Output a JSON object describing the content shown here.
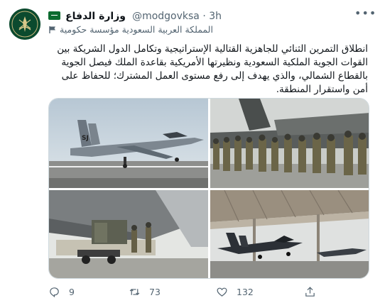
{
  "tweet": {
    "display_name": "وزارة الدفاع",
    "handle": "@modgovksa",
    "separator": "·",
    "time": "3h",
    "label": "المملكة العربية السعودية مؤسسة حكومية",
    "text": "انطلاق التمرين الثنائي للجاهزية القتالية الإستراتيجية وتكامل الدول الشريكة بين القوات الجوية الملكية السعودية ونظيرتها الأمريكية بقاعدة الملك فيصل الجوية بالقطاع الشمالي، والذي يهدف إلى رفع مستوى العمل المشترك؛ للحفاظ على أمن واستقرار المنطقة.",
    "media": [
      {
        "icon": "fighter-jet-photo",
        "tail_code": "SJ"
      },
      {
        "icon": "soldiers-cargo-plane-photo"
      },
      {
        "icon": "cargo-loading-photo"
      },
      {
        "icon": "hangar-jet-photo"
      }
    ]
  },
  "actions": {
    "reply_count": "9",
    "retweet_count": "73",
    "like_count": "132"
  },
  "icons": {
    "avatar": "ministry-emblem-icon",
    "verified_flag": "saudi-flag-icon",
    "more": "more-icon",
    "gov_label": "government-label-icon",
    "reply": "reply-icon",
    "retweet": "retweet-icon",
    "like": "heart-icon",
    "share": "share-icon"
  },
  "colors": {
    "text_primary": "#0f1419",
    "text_secondary": "#536471",
    "border": "#cfd9de",
    "avatar_bg": "#0b4a2e",
    "flag_green": "#0b6b2f"
  }
}
